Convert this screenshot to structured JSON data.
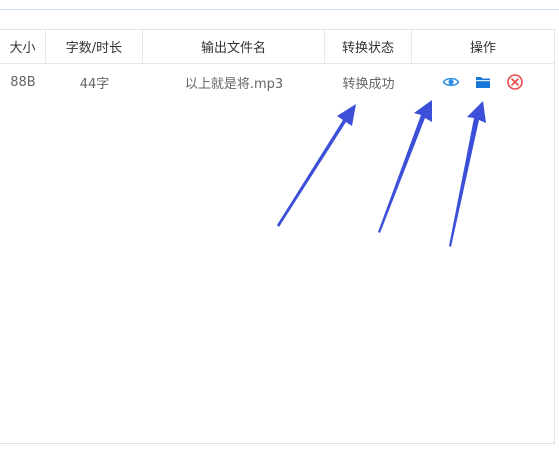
{
  "table": {
    "headers": {
      "size": "大小",
      "chars_duration": "字数/时长",
      "output_filename": "输出文件名",
      "status": "转换状态",
      "actions": "操作"
    },
    "rows": [
      {
        "size": "88B",
        "chars_duration": "44字",
        "output_filename": "以上就是将.mp3",
        "status": "转换成功",
        "actions": [
          "eye-icon",
          "folder-icon",
          "close-circle-icon"
        ]
      }
    ]
  },
  "colors": {
    "preview_icon": "#2f8de4",
    "folder_icon": "#1677d8",
    "delete_icon": "#e84a4a",
    "annotation_arrow": "#3b4fd8",
    "border": "#dbe4ee"
  }
}
